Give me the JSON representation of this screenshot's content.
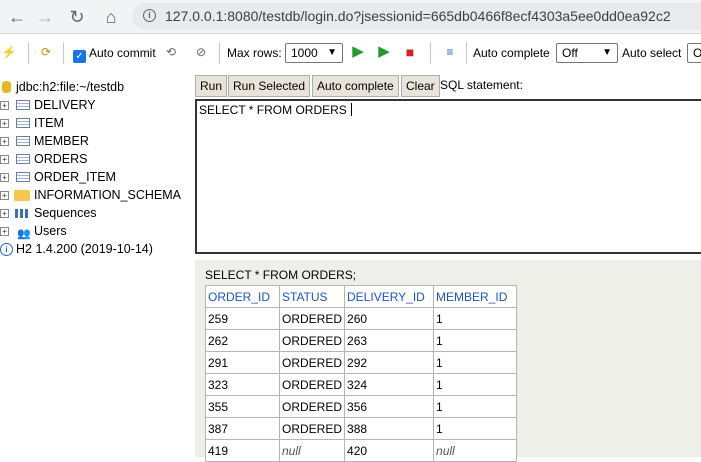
{
  "browser": {
    "back_icon": "←",
    "forward_icon": "→",
    "reload_icon": "↻",
    "home_icon": "⌂",
    "url": "127.0.0.1:8080/testdb/login.do?jsessionid=665db0466f8ecf4303a5ee0dd0ea92c2"
  },
  "toolbar": {
    "auto_commit_label": "Auto commit",
    "max_rows_label": "Max rows:",
    "max_rows_value": "1000",
    "auto_complete_label": "Auto complete",
    "auto_complete_value": "Off",
    "auto_select_label": "Auto select",
    "auto_select_value": "O"
  },
  "tree": {
    "connection": "jdbc:h2:file:~/testdb",
    "tables": [
      "DELIVERY",
      "ITEM",
      "MEMBER",
      "ORDERS",
      "ORDER_ITEM"
    ],
    "schema": "INFORMATION_SCHEMA",
    "sequences": "Sequences",
    "users": "Users",
    "version": "H2 1.4.200 (2019-10-14)"
  },
  "query": {
    "buttons": {
      "run": "Run",
      "run_selected": "Run Selected",
      "auto_complete": "Auto complete",
      "clear": "Clear"
    },
    "sql_label": "SQL statement:",
    "sql_text": "SELECT * FROM ORDERS"
  },
  "result": {
    "statement": "SELECT * FROM ORDERS;",
    "columns": [
      "ORDER_ID",
      "STATUS",
      "DELIVERY_ID",
      "MEMBER_ID"
    ],
    "rows": [
      [
        "259",
        "ORDERED",
        "260",
        "1"
      ],
      [
        "262",
        "ORDERED",
        "263",
        "1"
      ],
      [
        "291",
        "ORDERED",
        "292",
        "1"
      ],
      [
        "323",
        "ORDERED",
        "324",
        "1"
      ],
      [
        "355",
        "ORDERED",
        "356",
        "1"
      ],
      [
        "387",
        "ORDERED",
        "388",
        "1"
      ],
      [
        "419",
        "null",
        "420",
        "null"
      ]
    ]
  }
}
